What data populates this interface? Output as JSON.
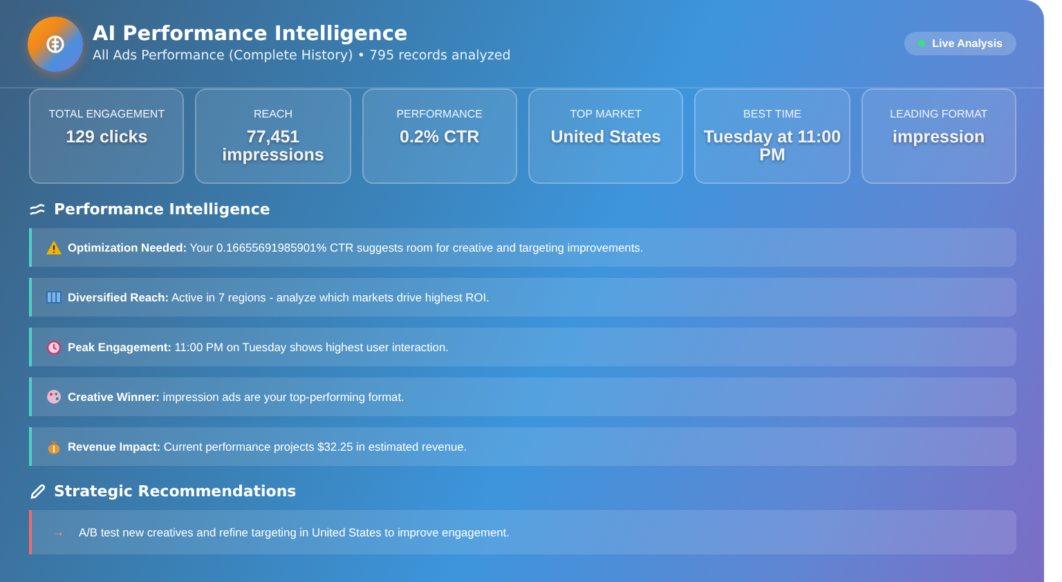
{
  "header": {
    "title": "AI Performance Intelligence",
    "subtitle": "All Ads Performance (Complete History) • 795 records analyzed",
    "status": {
      "label": "Live Analysis",
      "on": true
    }
  },
  "stats": [
    {
      "label": "TOTAL ENGAGEMENT",
      "value": "129 clicks"
    },
    {
      "label": "REACH",
      "value": "77,451 impressions"
    },
    {
      "label": "PERFORMANCE",
      "value": "0.2% CTR"
    },
    {
      "label": "TOP MARKET",
      "value": "United States"
    },
    {
      "label": "BEST TIME",
      "value": "Tuesday at 11:00 PM"
    },
    {
      "label": "LEADING FORMAT",
      "value": "impression"
    }
  ],
  "insights_section": {
    "title": "Performance Intelligence",
    "items": [
      {
        "kind": "warning",
        "text": "**Optimization Needed:** Your 0.16655691985901% CTR suggests room for creative and targeting improvements."
      },
      {
        "kind": "map",
        "text": "**Diversified Reach:** Active in 7 regions - analyze which markets drive highest ROI."
      },
      {
        "kind": "clock",
        "text": "**Peak Engagement:** 11:00 PM on Tuesday shows highest user interaction."
      },
      {
        "kind": "palette",
        "text": "**Creative Winner:** impression ads are your top-performing format."
      },
      {
        "kind": "money",
        "text": "**Revenue Impact:** Current performance projects $32.25 in estimated revenue."
      }
    ]
  },
  "recommendations_section": {
    "title": "Strategic Recommendations",
    "items": [
      {
        "marker": "→",
        "text": "A/B test new creatives and refine targeting in United States to improve engagement."
      }
    ]
  }
}
